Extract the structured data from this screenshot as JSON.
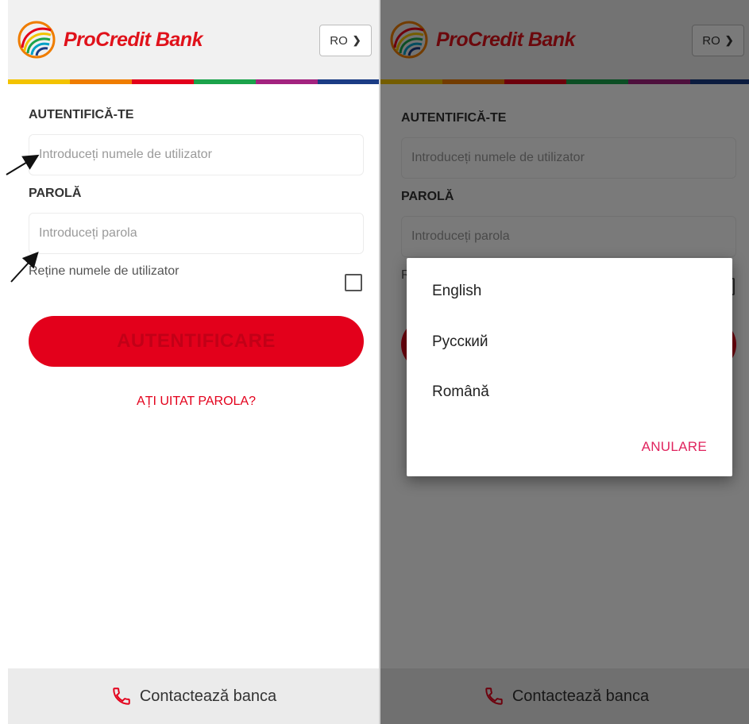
{
  "brand": {
    "name": "ProCredit Bank",
    "stripe_colors": [
      "#f3c300",
      "#ef7d00",
      "#e3001b",
      "#1ba34b",
      "#00a0c6",
      "#a3237f",
      "#1b3c85"
    ]
  },
  "header": {
    "language_code": "RO"
  },
  "login": {
    "username_label": "AUTENTIFICĂ-TE",
    "username_placeholder": "Introduceți numele de utilizator",
    "password_label": "PAROLĂ",
    "password_placeholder": "Introduceți parola",
    "remember_label": "Reține numele de utilizator",
    "submit_label": "AUTENTIFICARE",
    "forgot_label": "AȚI UITAT PAROLA?"
  },
  "footer": {
    "contact_label": "Contactează banca"
  },
  "language_dialog": {
    "options": [
      "English",
      "Русский",
      "Română"
    ],
    "cancel_label": "ANULARE"
  },
  "icons": {
    "logo": "procredit-logo-icon",
    "chevron": "chevron-down-icon",
    "phone": "phone-icon",
    "annotation": "arrow-icon"
  },
  "colors": {
    "accent": "#e3001b",
    "dialog_cancel": "#e0245e"
  }
}
